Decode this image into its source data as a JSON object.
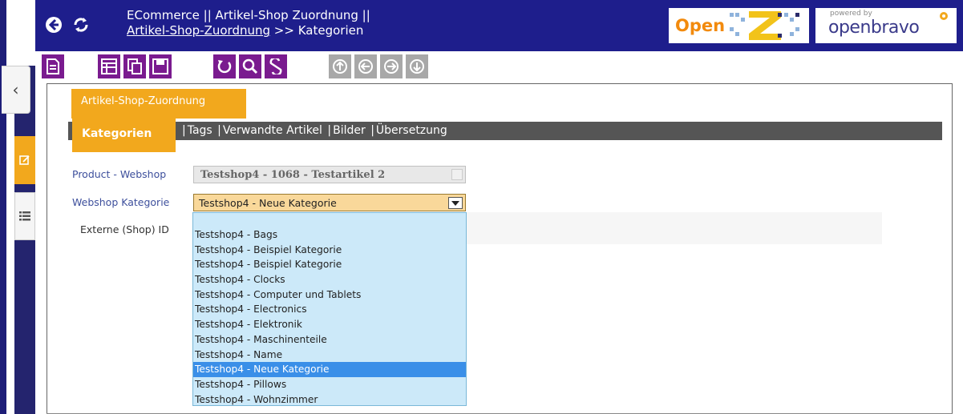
{
  "header": {
    "title_line1": "ECommerce || Artikel-Shop Zuordnung ||",
    "title_link": "Artikel-Shop-Zuordnung",
    "title_separator": ">>",
    "title_current": "Kategorien",
    "logo_left": "Open",
    "logo_right_small": "powered by",
    "logo_right": "openbravo",
    "back_icon": "back-circle-icon",
    "refresh_icon": "refresh-icon"
  },
  "toolbar": {
    "icons": [
      "new-document-icon",
      "grid-view-icon",
      "copy-icon",
      "save-icon",
      "undo-icon",
      "search-icon",
      "link-icon",
      "first-record-icon",
      "previous-record-icon",
      "next-record-icon",
      "last-record-icon"
    ]
  },
  "colors": {
    "header_bg": "#1e1e8c",
    "toolbar_purple": "#7a1b8f",
    "accent_orange": "#f2a81d",
    "tab_strip": "#555555",
    "selected_blue": "#3a8fe8",
    "dropdown_bg": "#cce9f9"
  },
  "tabs": {
    "window_tab": "Artikel-Shop-Zuordnung",
    "active_subtab": "Kategorien",
    "subtabs": [
      "Tags",
      "Verwandte Artikel",
      "Bilder",
      "Übersetzung"
    ]
  },
  "form": {
    "product_label": "Product - Webshop",
    "product_value": "Testshop4 - 1068 - Testartikel 2",
    "category_label": "Webshop Kategorie",
    "category_value": "Testshop4 - Neue Kategorie",
    "extern_label": "Externe (Shop) ID"
  },
  "dropdown": {
    "options": [
      "Testshop4 - Bags",
      "Testshop4 - Beispiel Kategorie",
      "Testshop4 - Beispiel Kategorie",
      "Testshop4 - Clocks",
      "Testshop4 - Computer und Tablets",
      "Testshop4 - Electronics",
      "Testshop4 - Elektronik",
      "Testshop4 - Maschinenteile",
      "Testshop4 - Name",
      "Testshop4 - Neue Kategorie",
      "Testshop4 - Pillows",
      "Testshop4 - Wohnzimmer"
    ],
    "selected_index": 9
  }
}
